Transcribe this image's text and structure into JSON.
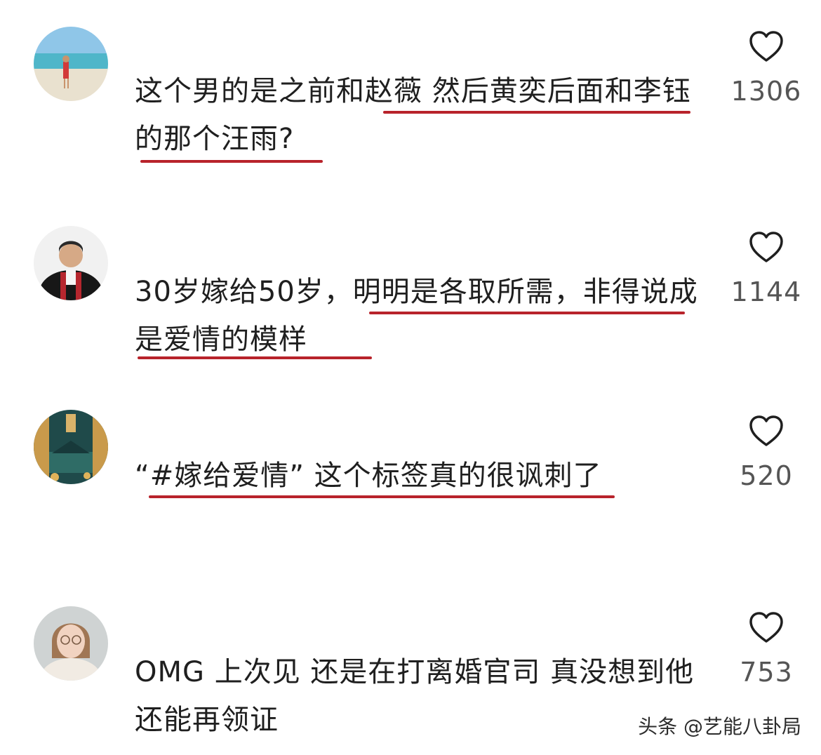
{
  "comments": [
    {
      "avatar": "beach-photo-avatar",
      "text": "这个男的是之前和赵薇 然后黄奕后面和李钰的那个汪雨?",
      "likes": "1306"
    },
    {
      "avatar": "graduation-photo-avatar",
      "text": "30岁嫁给50岁，明明是各取所需，非得说成是爱情的模样",
      "likes": "1144"
    },
    {
      "avatar": "autumn-festival-avatar",
      "text": "“#嫁给爱情” 这个标签真的很讽刺了",
      "likes": "520"
    },
    {
      "avatar": "woman-glasses-avatar",
      "text": "OMG 上次见 还是在打离婚官司 真没想到他还能再领证",
      "likes": "753"
    }
  ],
  "watermark": "头条 @艺能八卦局",
  "colors": {
    "underline": "#b8232b",
    "like_count": "#555555",
    "heart_outline": "#1f1f1f"
  },
  "icons": {
    "like": "heart-outline-icon"
  }
}
